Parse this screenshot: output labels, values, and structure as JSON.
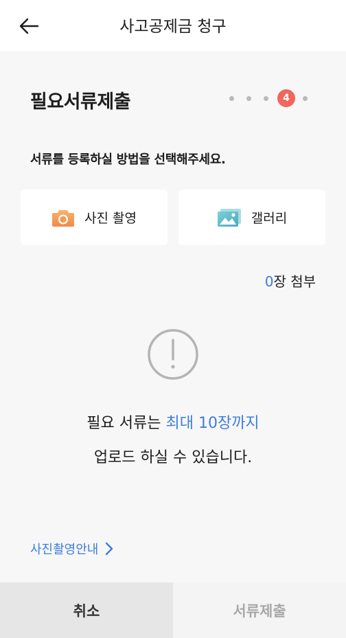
{
  "header": {
    "title": "사고공제금 청구",
    "back_icon": "arrow-left-icon"
  },
  "section": {
    "title": "필요서류제출",
    "current_step": "4"
  },
  "instruction": "서류를 등록하실 방법을 선택해주세요.",
  "options": {
    "camera_label": "사진 촬영",
    "gallery_label": "갤러리"
  },
  "attachments": {
    "count": "0",
    "suffix": "장 첨부"
  },
  "notice": {
    "line1_prefix": "필요 서류는 ",
    "line1_highlight": "최대 10장까지",
    "line2": "업로드 하실 수 있습니다."
  },
  "guide_link": "사진촬영안내",
  "footer": {
    "cancel": "취소",
    "submit": "서류제출"
  },
  "colors": {
    "accent_blue": "#3b7ddd",
    "step_red": "#f0675e",
    "camera_orange": "#f5a25d",
    "gallery_teal": "#5fbcc9"
  }
}
